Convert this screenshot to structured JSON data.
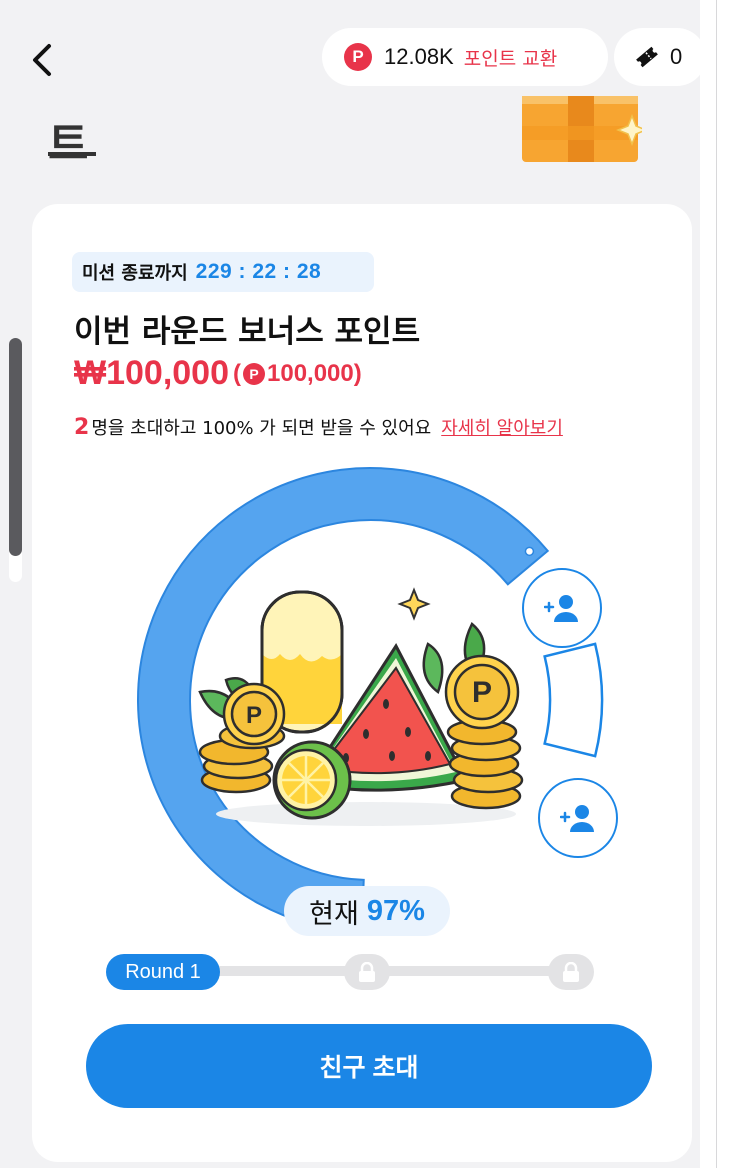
{
  "header": {
    "back_icon": "chevron-left-icon",
    "points_badge": "P",
    "points_value": "12.08K",
    "points_exchange_label": "포인트 교환",
    "ticket_icon": "ticket-icon",
    "ticket_count": "0"
  },
  "page": {
    "title_fragment": "트",
    "gift_icon": "gift-box-icon"
  },
  "mission": {
    "timer_label": "미션 종료까지",
    "timer_value": "229 : 22 : 28",
    "round_title": "이번 라운드 보너스 포인트",
    "reward_won": "₩100,000",
    "reward_points_open": "(",
    "reward_points_badge": "P",
    "reward_points_value": "100,000)",
    "invite_count": "2",
    "invite_text": "명을 초대하고 100% 가 되면 받을 수 있어요",
    "learn_more_label": "자세히 알아보기"
  },
  "progress": {
    "current_label": "현재",
    "current_value": "97%",
    "percent": 97,
    "friend_slot_icon": "add-person-icon"
  },
  "rounds": {
    "round_label": "Round 1",
    "lock_icon": "lock-icon",
    "total_rounds": 3
  },
  "cta": {
    "invite_button_label": "친구 초대"
  },
  "colors": {
    "primary_blue": "#1b86e6",
    "accent_red": "#e8344a",
    "gauge_blue": "#55a4ef",
    "light_blue_bg": "#eaf3fd"
  }
}
